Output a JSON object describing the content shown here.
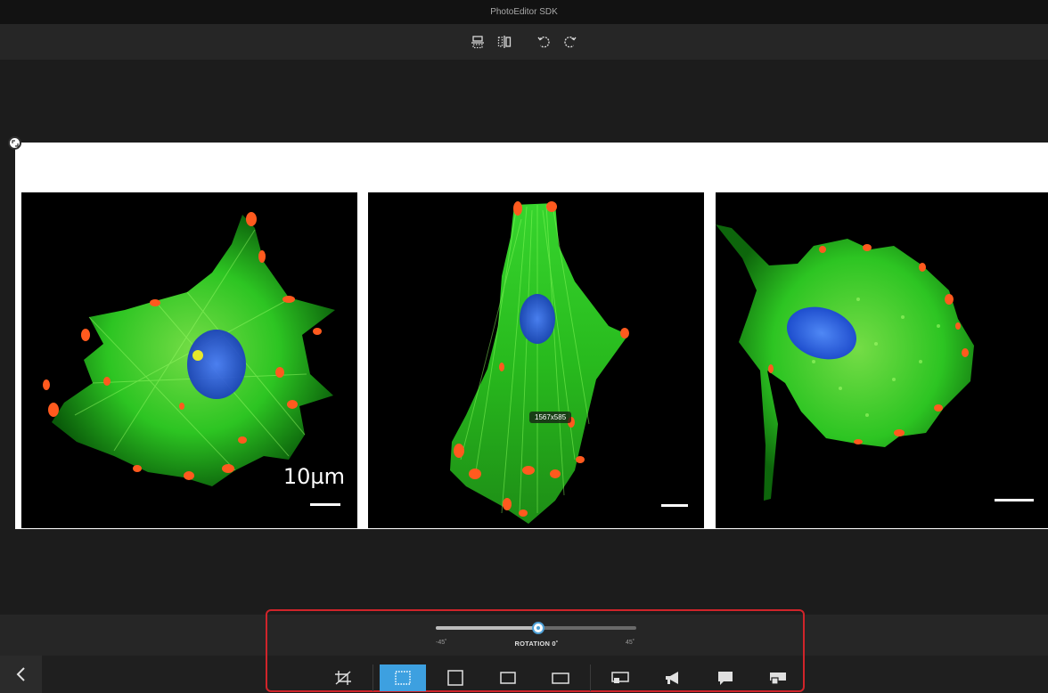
{
  "window": {
    "title": "PhotoEditor SDK"
  },
  "toolbar": {
    "items": [
      {
        "name": "flip-vertical-button",
        "icon": "flip-vertical-icon"
      },
      {
        "name": "flip-horizontal-button",
        "icon": "flip-horizontal-icon"
      },
      {
        "name": "rotate-left-button",
        "icon": "rotate-left-icon"
      },
      {
        "name": "rotate-right-button",
        "icon": "rotate-right-icon"
      }
    ]
  },
  "image": {
    "panels": [
      {
        "scale_label": "10µm"
      },
      {
        "scale_label": ""
      },
      {
        "scale_label": ""
      }
    ],
    "size_badge": "1567x585"
  },
  "rotation": {
    "min_label": "-45˚",
    "max_label": "45˚",
    "caption": "ROTATION 0˚",
    "value": 0,
    "min": -45,
    "max": 45
  },
  "crop_ratios": {
    "items": [
      {
        "name": "crop-free-off",
        "icon": "crop-off-icon",
        "active": false
      },
      {
        "name": "crop-custom",
        "icon": "crop-custom-icon",
        "active": true
      },
      {
        "name": "crop-square",
        "icon": "square-ratio-icon",
        "active": false
      },
      {
        "name": "crop-4-3",
        "icon": "ratio-4-3-icon",
        "active": false
      },
      {
        "name": "crop-16-9",
        "icon": "ratio-16-9-icon",
        "active": false
      },
      {
        "name": "preset-facebook-cover",
        "icon": "cover-photo-icon",
        "active": false
      },
      {
        "name": "preset-announcement",
        "icon": "megaphone-icon",
        "active": false
      },
      {
        "name": "preset-speech",
        "icon": "speech-bubble-icon",
        "active": false
      },
      {
        "name": "preset-profile",
        "icon": "profile-photo-icon",
        "active": false
      }
    ]
  },
  "colors": {
    "accent": "#3da0e0",
    "highlight": "#d0242a",
    "background": "#1c1c1c",
    "actin": "#2fe02a",
    "adhesion": "#ff5a1e",
    "nucleus": "#2b5dff"
  }
}
